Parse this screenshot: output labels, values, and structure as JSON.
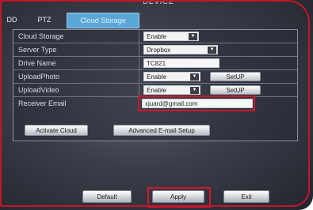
{
  "window": {
    "title": "DEVICE"
  },
  "tabs": [
    {
      "label": "DD"
    },
    {
      "label": "PTZ"
    },
    {
      "label": "Cloud Storage",
      "active": true
    }
  ],
  "form": {
    "rows": [
      {
        "label": "Cloud Storage",
        "value": "Enable",
        "kind": "select"
      },
      {
        "label": "Server Type",
        "value": "Dropbox",
        "kind": "select"
      },
      {
        "label": "Drive Name",
        "value": "TC821",
        "kind": "text"
      },
      {
        "label": "UploadPhoto",
        "value": "Enable",
        "kind": "select",
        "button": "SetUP"
      },
      {
        "label": "UploadVideo",
        "value": "Enable",
        "kind": "select",
        "button": "SetUP"
      },
      {
        "label": "Receiver Email",
        "value": "xjuard@gmail.com",
        "kind": "text"
      }
    ]
  },
  "actions": {
    "activate_cloud": "Activate Cloud",
    "advanced_email": "Advanced E-mail Setup"
  },
  "footer": {
    "default": "Default",
    "apply": "Apply",
    "exit": "Exit"
  },
  "colors": {
    "highlight": "#d41628",
    "active_tab": "#5aa7d8"
  }
}
